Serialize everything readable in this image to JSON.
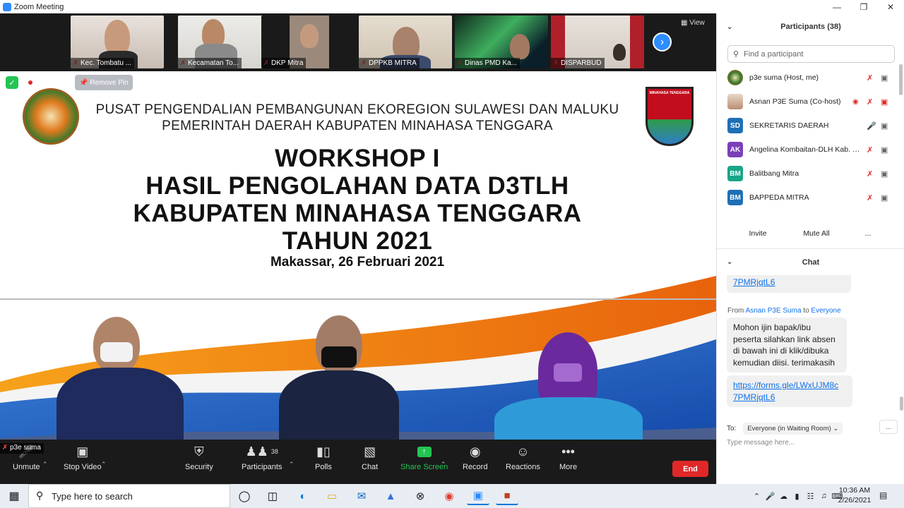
{
  "window": {
    "title": "Zoom Meeting"
  },
  "thumbnails": [
    {
      "name": "Kec. Tombatu ..."
    },
    {
      "name": "Kecamatan To..."
    },
    {
      "name": "DKP Mitra"
    },
    {
      "name": "DPPKB MITRA"
    },
    {
      "name": "Dinas PMD Ka..."
    },
    {
      "name": "DISPARBUD"
    }
  ],
  "view_label": "View",
  "remove_pin_label": "Remove Pin",
  "slide": {
    "org_line1": "PUSAT PENGENDALIAN PEMBANGUNAN EKOREGION SULAWESI DAN MALUKU",
    "org_line2": "PEMERINTAH DAERAH KABUPATEN MINAHASA TENGGARA",
    "title_line1": "WORKSHOP I",
    "title_line2": "HASIL PENGOLAHAN DATA D3TLH",
    "title_line3": "KABUPATEN MINAHASA TENGGARA",
    "title_line4": "TAHUN 2021",
    "place_date": "Makassar, 26 Februari 2021",
    "logo_right_text": "MINAHASA TENGGARA"
  },
  "active_speaker": "p3e suma",
  "toolbar": {
    "unmute": "Unmute",
    "stop_video": "Stop Video",
    "security": "Security",
    "participants": "Participants",
    "participants_count": "38",
    "polls": "Polls",
    "chat": "Chat",
    "share_screen": "Share Screen",
    "record": "Record",
    "reactions": "Reactions",
    "more": "More",
    "end": "End"
  },
  "participants_panel": {
    "title": "Participants (38)",
    "search_placeholder": "Find a participant",
    "list": [
      {
        "name": "p3e suma (Host, me)",
        "initials": "",
        "color": ""
      },
      {
        "name": "Asnan P3E Suma (Co-host)",
        "initials": "",
        "color": ""
      },
      {
        "name": "SEKRETARIS DAERAH",
        "initials": "SD",
        "color": "#1f6fb5"
      },
      {
        "name": "Angelina Kombaitan-DLH Kab. Mi...",
        "initials": "AK",
        "color": "#7b3fb8"
      },
      {
        "name": "Balitbang Mitra",
        "initials": "BM",
        "color": "#17a589"
      },
      {
        "name": "BAPPEDA MITRA",
        "initials": "BM",
        "color": "#1f6fb5"
      }
    ],
    "invite": "Invite",
    "mute_all": "Mute All",
    "more": "..."
  },
  "chat_panel": {
    "title": "Chat",
    "prev_link_tail": "7PMRjqtL6",
    "from_label": "From",
    "from_name": "Asnan P3E Suma",
    "to_word": "to",
    "to_name": "Everyone",
    "message_text": "Mohon ijin bapak/ibu peserta silahkan link absen di bawah ini di klik/dibuka kemudian diisi. terimakasih",
    "link_line1": "https://forms.gle/LWxUJM8c",
    "link_line2": "7PMRjqtL6",
    "to_label": "To:",
    "to_value": "Everyone (in Waiting Room)",
    "more": "...",
    "placeholder": "Type message here..."
  },
  "taskbar": {
    "search_placeholder": "Type here to search",
    "time": "10:36 AM",
    "date": "2/26/2021"
  }
}
